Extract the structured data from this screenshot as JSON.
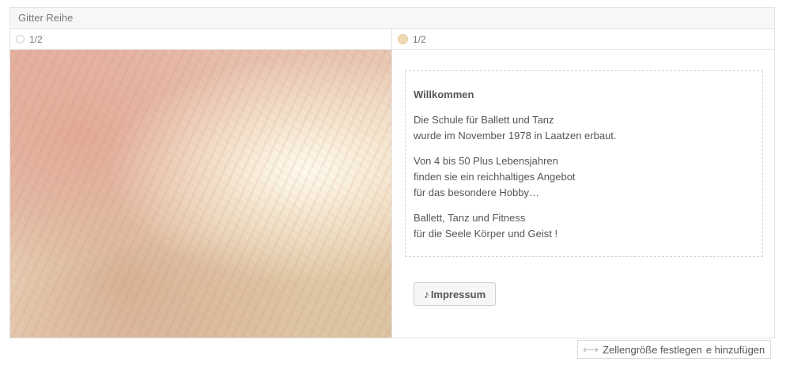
{
  "row": {
    "title": "Gitter Reihe"
  },
  "columns": [
    {
      "label": "1/2",
      "dot_color": "#ffffff"
    },
    {
      "label": "1/2",
      "dot_color": "#efd9b4"
    }
  ],
  "content": {
    "headline": "Willkommen",
    "para1_line1": "Die Schule für Ballett und Tanz",
    "para1_line2": "wurde im November 1978 in Laatzen erbaut.",
    "para2_line1": "Von 4 bis 50 Plus Lebensjahren",
    "para2_line2": "finden sie ein reichhaltiges Angebot",
    "para2_line3": "für das besondere Hobby…",
    "para3_line1": "Ballett, Tanz und Fitness",
    "para3_line2": "für die Seele Körper und Geist !"
  },
  "button": {
    "icon": "music-note-icon",
    "glyph": "♪",
    "label": "Impressum"
  },
  "bottom_bar": {
    "resize_icon": "horizontal-resize-icon",
    "resize_label": "Zellengröße festlegen",
    "add_label": "e hinzufügen"
  }
}
